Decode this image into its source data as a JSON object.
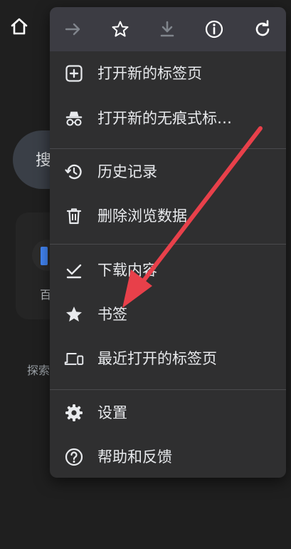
{
  "background": {
    "search_text": "搜",
    "tile_label": "百",
    "explore_text": "探索"
  },
  "toolbar": {
    "buttons": [
      {
        "icon": "forward-arrow-icon",
        "enabled": false
      },
      {
        "icon": "star-outline-icon",
        "enabled": true
      },
      {
        "icon": "download-icon",
        "enabled": false
      },
      {
        "icon": "info-icon",
        "enabled": true
      },
      {
        "icon": "refresh-icon",
        "enabled": true
      }
    ]
  },
  "menu": {
    "items": [
      {
        "label": "打开新的标签页",
        "icon": "new-tab-icon"
      },
      {
        "label": "打开新的无痕式标…",
        "icon": "incognito-icon"
      },
      {
        "label": "历史记录",
        "icon": "history-icon"
      },
      {
        "label": "删除浏览数据",
        "icon": "trash-icon"
      },
      {
        "label": "下载内容",
        "icon": "downloads-check-icon"
      },
      {
        "label": "书签",
        "icon": "bookmark-star-icon"
      },
      {
        "label": "最近打开的标签页",
        "icon": "recent-tabs-devices-icon"
      },
      {
        "label": "设置",
        "icon": "gear-icon"
      },
      {
        "label": "帮助和反馈",
        "icon": "help-icon"
      }
    ]
  },
  "colors": {
    "annotation_arrow": "#e8404a",
    "menu_background": "#2f2f30",
    "toolbar_background": "#3c3c43",
    "disabled_icon": "#80858c"
  }
}
